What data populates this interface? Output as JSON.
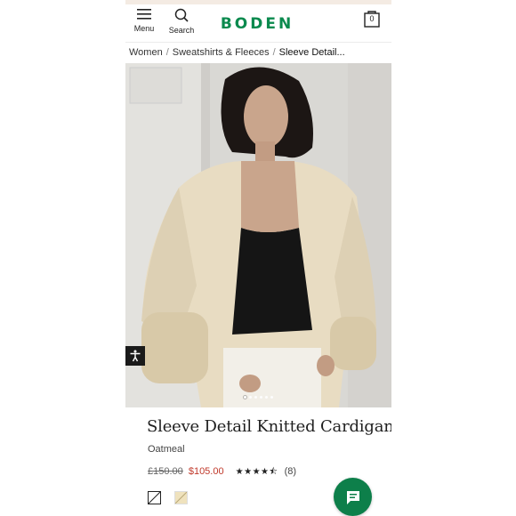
{
  "header": {
    "menu_label": "Menu",
    "search_label": "Search",
    "logo_text": "BODEN",
    "bag_count": "0"
  },
  "breadcrumb": {
    "items": [
      "Women",
      "Sweatshirts & Fleeces",
      "Sleeve Detail..."
    ]
  },
  "gallery": {
    "image_count": 6,
    "active_index": 0
  },
  "product": {
    "title": "Sleeve Detail Knitted Cardigan",
    "color": "Oatmeal",
    "price_was": "£150.00",
    "price_now": "$105.00",
    "rating": 4.5,
    "rating_stars": "★★★★⯪",
    "review_count": "(8)"
  },
  "swatches": [
    {
      "name": "white-swatch",
      "hex": "#ffffff",
      "selected": true
    },
    {
      "name": "oatmeal-swatch",
      "hex": "#efe2bd",
      "selected": false
    }
  ],
  "colors": {
    "brand": "#0b8a4e",
    "sale_price": "#c0392b",
    "chat_button": "#0d7f4a"
  },
  "icons": [
    "hamburger-menu-icon",
    "search-icon",
    "shopping-bag-icon",
    "accessibility-icon",
    "chat-icon"
  ]
}
